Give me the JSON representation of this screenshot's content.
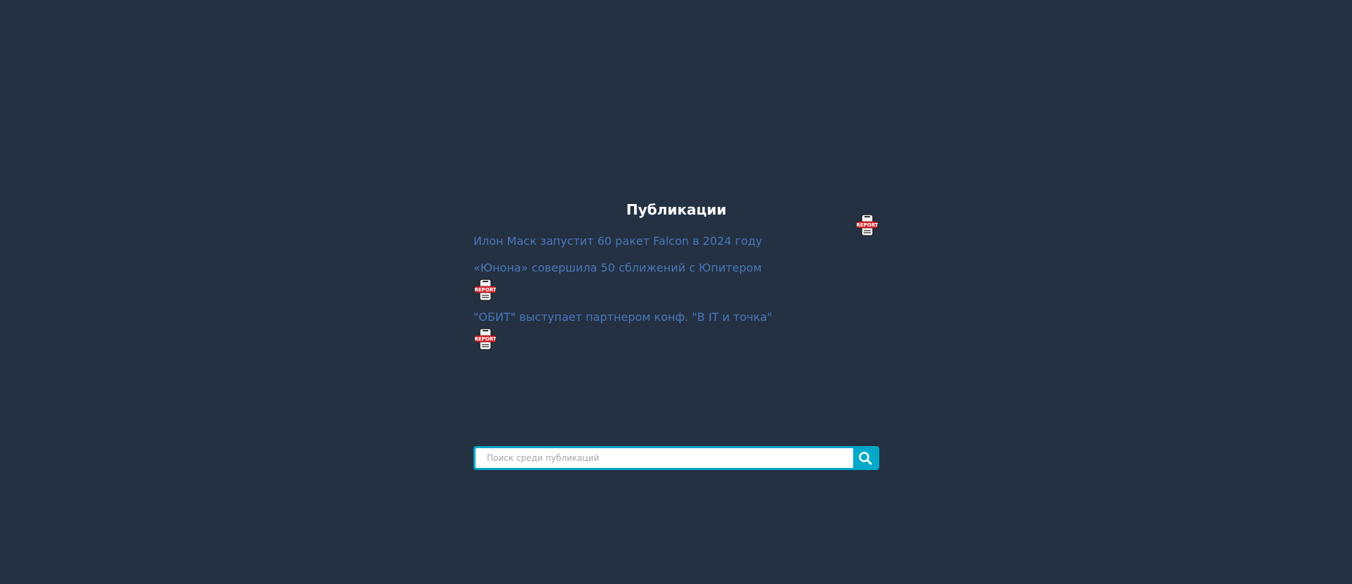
{
  "page": {
    "title": "Публикации"
  },
  "publications": [
    {
      "title": "Илон Маск запустит 60 ракет Falcon в 2024 году",
      "icon": "report-icon"
    },
    {
      "title": "«Юнона» совершила 50 сближений с Юпитером",
      "icon": "report-icon"
    },
    {
      "title": "\"ОБИТ\" выступает партнером конф. \"В IT и точка\"",
      "icon": "report-icon"
    }
  ],
  "search": {
    "placeholder": "Поиск среди публикаций",
    "value": "",
    "icon": "search-icon"
  },
  "colors": {
    "background": "#243143",
    "link": "#4a77b9",
    "accent": "#00a9c9"
  },
  "report_icon_label": "REPORT"
}
